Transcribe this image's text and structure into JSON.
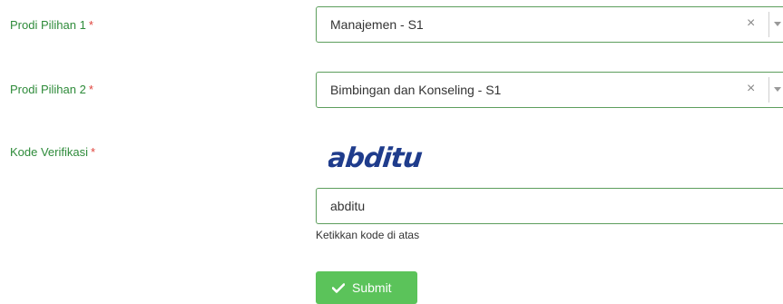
{
  "form": {
    "prodi1": {
      "label": "Prodi Pilihan 1",
      "required_mark": "*",
      "value": "Manajemen - S1"
    },
    "prodi2": {
      "label": "Prodi Pilihan 2",
      "required_mark": "*",
      "value": "Bimbingan dan Konseling - S1"
    },
    "verification": {
      "label": "Kode Verifikasi",
      "required_mark": "*",
      "captcha_text": "abditu",
      "input_value": "abditu",
      "helper": "Ketikkan kode di atas"
    },
    "submit_label": "Submit"
  },
  "colors": {
    "label": "#2e8b3a",
    "required": "#e0443c",
    "border": "#5d9e5d",
    "captcha": "#1f3c8c",
    "submit_bg": "#5bc35a"
  },
  "icons": {
    "clear": "×",
    "dropdown": "chevron-down-icon",
    "submit": "check-icon"
  }
}
